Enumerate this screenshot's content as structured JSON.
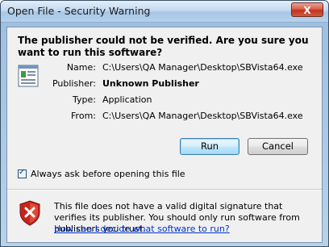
{
  "window": {
    "title": "Open File - Security Warning",
    "close_label": "X"
  },
  "dialog": {
    "headline": "The publisher could not be verified.  Are you sure you want to run this software?",
    "fields": [
      {
        "label": "Name:",
        "value": "C:\\Users\\QA Manager\\Desktop\\SBVista64.exe",
        "bold": false
      },
      {
        "label": "Publisher:",
        "value": "Unknown Publisher",
        "bold": true
      },
      {
        "label": "Type:",
        "value": "Application",
        "bold": false
      },
      {
        "label": "From:",
        "value": "C:\\Users\\QA Manager\\Desktop\\SBVista64.exe",
        "bold": false
      }
    ],
    "buttons": {
      "run_label": "Run",
      "cancel_label": "Cancel"
    },
    "checkbox": {
      "label": "Always ask before opening this file",
      "checked": true
    },
    "warning": {
      "text": "This file does not have a valid digital signature that verifies its publisher.  You should only run software from publishers you trust.",
      "link": "How can I decide what software to run?"
    }
  },
  "icons": {
    "app": "application-icon",
    "shield": "security-shield-warning-icon"
  },
  "colors": {
    "link": "#0033cc",
    "shield_red": "#c4241c",
    "default_button_border": "#3c7fb1"
  }
}
